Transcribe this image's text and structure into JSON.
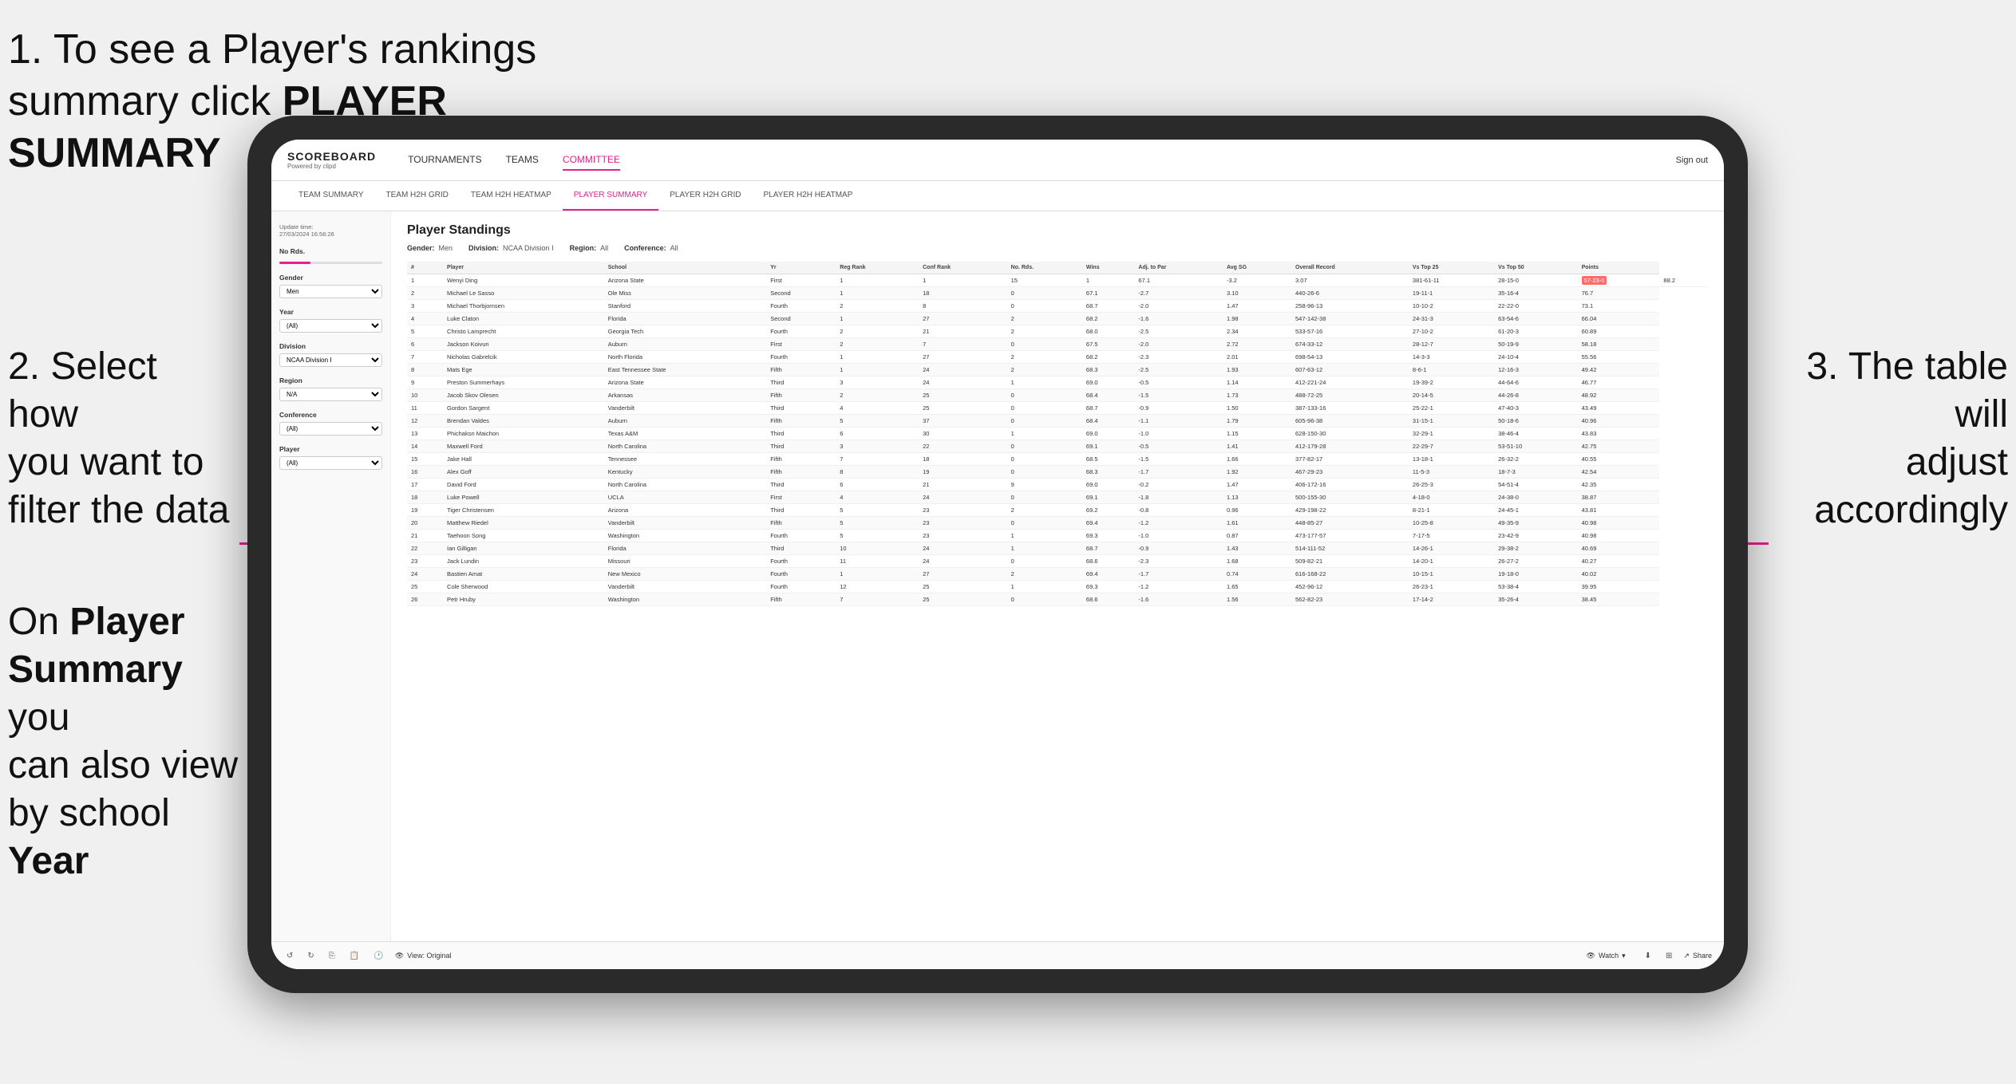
{
  "annotations": {
    "top_left_line1": "1. To see a Player's rankings",
    "top_left_line2": "summary click ",
    "top_left_bold": "PLAYER SUMMARY",
    "mid_left_line1": "2. Select how",
    "mid_left_line2": "you want to",
    "mid_left_line3": "filter the data",
    "bottom_left_line1": "On ",
    "bottom_left_bold1": "Player",
    "bottom_left_line2": "Summary",
    "bottom_left_line3": " you",
    "bottom_left_line4": "can also view",
    "bottom_left_line5": "by school ",
    "bottom_left_bold2": "Year",
    "right_line1": "3. The table will",
    "right_line2": "adjust accordingly"
  },
  "nav": {
    "logo": "SCOREBOARD",
    "logo_sub": "Powered by clipd",
    "items": [
      "TOURNAMENTS",
      "TEAMS",
      "COMMITTEE"
    ],
    "sign_out": "Sign out"
  },
  "sub_nav": {
    "items": [
      "TEAM SUMMARY",
      "TEAM H2H GRID",
      "TEAM H2H HEATMAP",
      "PLAYER SUMMARY",
      "PLAYER H2H GRID",
      "PLAYER H2H HEATMAP"
    ],
    "active": "PLAYER SUMMARY"
  },
  "sidebar": {
    "update_label": "Update time:",
    "update_time": "27/03/2024 16:56:26",
    "no_rds_label": "No Rds.",
    "gender_label": "Gender",
    "gender_value": "Men",
    "year_label": "Year",
    "year_value": "(All)",
    "division_label": "Division",
    "division_value": "NCAA Division I",
    "region_label": "Region",
    "region_value": "N/A",
    "conference_label": "Conference",
    "conference_value": "(All)",
    "player_label": "Player",
    "player_value": "(All)"
  },
  "table": {
    "title": "Player Standings",
    "filters": {
      "gender_label": "Gender:",
      "gender_val": "Men",
      "division_label": "Division:",
      "division_val": "NCAA Division I",
      "region_label": "Region:",
      "region_val": "All",
      "conference_label": "Conference:",
      "conference_val": "All"
    },
    "columns": [
      "#",
      "Player",
      "School",
      "Yr",
      "Reg Rank",
      "Conf Rank",
      "No. Rds.",
      "Wins",
      "Adj. to Par",
      "Avg SG",
      "Overall Record",
      "Vs Top 25",
      "Vs Top 50",
      "Points"
    ],
    "rows": [
      [
        "1",
        "Wenyi Ding",
        "Arizona State",
        "First",
        "1",
        "1",
        "15",
        "1",
        "67.1",
        "-3.2",
        "3.07",
        "381-61-11",
        "28-15-0",
        "57-23-0",
        "88.2"
      ],
      [
        "2",
        "Michael Le Sasso",
        "Ole Miss",
        "Second",
        "1",
        "18",
        "0",
        "67.1",
        "-2.7",
        "3.10",
        "440-26-6",
        "19-11-1",
        "35-16-4",
        "76.7"
      ],
      [
        "3",
        "Michael Thorbjornsen",
        "Stanford",
        "Fourth",
        "2",
        "8",
        "0",
        "68.7",
        "-2.0",
        "1.47",
        "258-96-13",
        "10-10-2",
        "22-22-0",
        "73.1"
      ],
      [
        "4",
        "Luke Claton",
        "Florida",
        "Second",
        "1",
        "27",
        "2",
        "68.2",
        "-1.6",
        "1.98",
        "547-142-38",
        "24-31-3",
        "63-54-6",
        "66.04"
      ],
      [
        "5",
        "Christo Lamprecht",
        "Georgia Tech",
        "Fourth",
        "2",
        "21",
        "2",
        "68.0",
        "-2.5",
        "2.34",
        "533-57-16",
        "27-10-2",
        "61-20-3",
        "60.89"
      ],
      [
        "6",
        "Jackson Koivun",
        "Auburn",
        "First",
        "2",
        "7",
        "0",
        "67.5",
        "-2.0",
        "2.72",
        "674-33-12",
        "28-12-7",
        "50-19-9",
        "58.18"
      ],
      [
        "7",
        "Nicholas Gabrelcik",
        "North Florida",
        "Fourth",
        "1",
        "27",
        "2",
        "68.2",
        "-2.3",
        "2.01",
        "698-54-13",
        "14-3-3",
        "24-10-4",
        "55.56"
      ],
      [
        "8",
        "Mats Ege",
        "East Tennessee State",
        "Fifth",
        "1",
        "24",
        "2",
        "68.3",
        "-2.5",
        "1.93",
        "607-63-12",
        "8-6-1",
        "12-16-3",
        "49.42"
      ],
      [
        "9",
        "Preston Summerhays",
        "Arizona State",
        "Third",
        "3",
        "24",
        "1",
        "69.0",
        "-0.5",
        "1.14",
        "412-221-24",
        "19-39-2",
        "44-64-6",
        "46.77"
      ],
      [
        "10",
        "Jacob Skov Olesen",
        "Arkansas",
        "Fifth",
        "2",
        "25",
        "0",
        "68.4",
        "-1.5",
        "1.73",
        "488-72-25",
        "20-14-5",
        "44-26-8",
        "48.92"
      ],
      [
        "11",
        "Gordon Sargent",
        "Vanderbilt",
        "Third",
        "4",
        "25",
        "0",
        "68.7",
        "-0.9",
        "1.50",
        "387-133-16",
        "25-22-1",
        "47-40-3",
        "43.49"
      ],
      [
        "12",
        "Brendan Valdes",
        "Auburn",
        "Fifth",
        "5",
        "37",
        "0",
        "68.4",
        "-1.1",
        "1.79",
        "605-96-38",
        "31-15-1",
        "50-18-6",
        "40.96"
      ],
      [
        "13",
        "Phichaksn Maichon",
        "Texas A&M",
        "Third",
        "6",
        "30",
        "1",
        "69.0",
        "-1.0",
        "1.15",
        "628-150-30",
        "32-29-1",
        "38-46-4",
        "43.83"
      ],
      [
        "14",
        "Maxwell Ford",
        "North Carolina",
        "Third",
        "3",
        "22",
        "0",
        "69.1",
        "-0.5",
        "1.41",
        "412-179-28",
        "22-29-7",
        "53-51-10",
        "42.75"
      ],
      [
        "15",
        "Jake Hall",
        "Tennessee",
        "Fifth",
        "7",
        "18",
        "0",
        "68.5",
        "-1.5",
        "1.66",
        "377-82-17",
        "13-18-1",
        "26-32-2",
        "40.55"
      ],
      [
        "16",
        "Alex Goff",
        "Kentucky",
        "Fifth",
        "8",
        "19",
        "0",
        "68.3",
        "-1.7",
        "1.92",
        "467-29-23",
        "11-5-3",
        "18-7-3",
        "42.54"
      ],
      [
        "17",
        "David Ford",
        "North Carolina",
        "Third",
        "6",
        "21",
        "9",
        "69.0",
        "-0.2",
        "1.47",
        "406-172-16",
        "26-25-3",
        "54-51-4",
        "42.35"
      ],
      [
        "18",
        "Luke Powell",
        "UCLA",
        "First",
        "4",
        "24",
        "0",
        "69.1",
        "-1.8",
        "1.13",
        "500-155-30",
        "4-18-0",
        "24-38-0",
        "38.87"
      ],
      [
        "19",
        "Tiger Christensen",
        "Arizona",
        "Third",
        "5",
        "23",
        "2",
        "69.2",
        "-0.8",
        "0.96",
        "429-198-22",
        "8-21-1",
        "24-45-1",
        "43.81"
      ],
      [
        "20",
        "Matthew Riedel",
        "Vanderbilt",
        "Fifth",
        "5",
        "23",
        "0",
        "69.4",
        "-1.2",
        "1.61",
        "448-85-27",
        "10-25-8",
        "49-35-9",
        "40.98"
      ],
      [
        "21",
        "Taehoon Song",
        "Washington",
        "Fourth",
        "5",
        "23",
        "1",
        "69.3",
        "-1.0",
        "0.87",
        "473-177-57",
        "7-17-5",
        "23-42-9",
        "40.98"
      ],
      [
        "22",
        "Ian Gilligan",
        "Florida",
        "Third",
        "10",
        "24",
        "1",
        "68.7",
        "-0.9",
        "1.43",
        "514-111-52",
        "14-26-1",
        "29-38-2",
        "40.69"
      ],
      [
        "23",
        "Jack Lundin",
        "Missouri",
        "Fourth",
        "11",
        "24",
        "0",
        "68.6",
        "-2.3",
        "1.68",
        "509-82-21",
        "14-20-1",
        "26-27-2",
        "40.27"
      ],
      [
        "24",
        "Bastien Amat",
        "New Mexico",
        "Fourth",
        "1",
        "27",
        "2",
        "69.4",
        "-1.7",
        "0.74",
        "616-168-22",
        "10-15-1",
        "19-18-0",
        "40.02"
      ],
      [
        "25",
        "Cole Sherwood",
        "Vanderbilt",
        "Fourth",
        "12",
        "25",
        "1",
        "69.3",
        "-1.2",
        "1.65",
        "452-96-12",
        "26-23-1",
        "53-38-4",
        "39.95"
      ],
      [
        "26",
        "Petr Hruby",
        "Washington",
        "Fifth",
        "7",
        "25",
        "0",
        "68.6",
        "-1.6",
        "1.56",
        "562-82-23",
        "17-14-2",
        "35-26-4",
        "38.45"
      ]
    ]
  },
  "toolbar": {
    "view_label": "View: Original",
    "watch_label": "Watch",
    "share_label": "Share"
  }
}
